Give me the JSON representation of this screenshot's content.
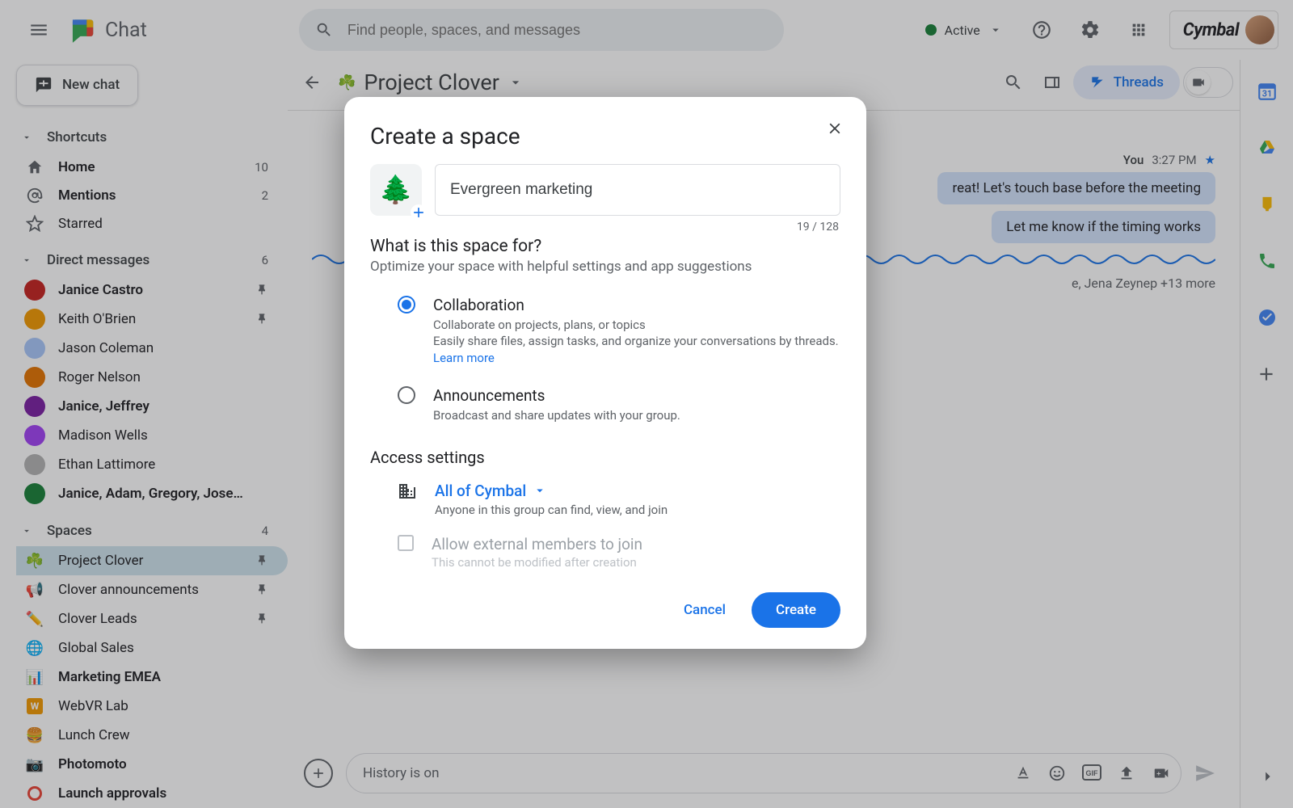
{
  "topbar": {
    "app_name": "Chat",
    "search_placeholder": "Find people, spaces, and messages",
    "active_label": "Active",
    "brand": "Cymbal"
  },
  "sidebar": {
    "new_chat": "New chat",
    "sections": {
      "shortcuts": {
        "label": "Shortcuts",
        "items": [
          {
            "label": "Home",
            "count": "10",
            "bold": true
          },
          {
            "label": "Mentions",
            "count": "2",
            "bold": true
          },
          {
            "label": "Starred"
          }
        ]
      },
      "dms": {
        "label": "Direct messages",
        "count": "6",
        "items": [
          {
            "label": "Janice Castro",
            "bold": true,
            "pin": true
          },
          {
            "label": "Keith O'Brien",
            "pin": true
          },
          {
            "label": "Jason Coleman"
          },
          {
            "label": "Roger Nelson"
          },
          {
            "label": "Janice, Jeffrey",
            "bold": true
          },
          {
            "label": "Madison Wells"
          },
          {
            "label": "Ethan Lattimore"
          },
          {
            "label": "Janice, Adam, Gregory, Jose…",
            "bold": true
          }
        ]
      },
      "spaces": {
        "label": "Spaces",
        "count": "4",
        "items": [
          {
            "emoji": "☘️",
            "label": "Project Clover",
            "pin": true,
            "active": true
          },
          {
            "emoji": "📢",
            "label": "Clover announcements",
            "pin": true
          },
          {
            "emoji": "✏️",
            "label": "Clover Leads",
            "pin": true
          },
          {
            "emoji": "🌐",
            "label": "Global Sales"
          },
          {
            "emoji": "📊",
            "label": "Marketing EMEA",
            "bold": true
          },
          {
            "emoji": "W",
            "label": "WebVR Lab"
          },
          {
            "emoji": "🍔",
            "label": "Lunch Crew"
          },
          {
            "emoji": "📷",
            "label": "Photomoto",
            "bold": true
          },
          {
            "emoji": "◯",
            "label": "Launch approvals",
            "bold": true
          }
        ]
      }
    }
  },
  "conv": {
    "title": "Project Clover",
    "threads_label": "Threads",
    "meta_you": "You",
    "meta_time": "3:27 PM",
    "msg1": "reat! Let's touch base before the meeting",
    "msg2": "Let me know if the timing works",
    "viewers": "e, Jena Zeynep +13 more",
    "composer_placeholder": "History is on"
  },
  "dialog": {
    "title": "Create a space",
    "emoji": "🌲",
    "name_value": "Evergreen marketing",
    "counter": "19 / 128",
    "section1_hd": "What is this space for?",
    "section1_txt": "Optimize your space with helpful settings and app suggestions",
    "opt_collab": {
      "title": "Collaboration",
      "desc": "Collaborate on projects, plans, or topics\nEasily share files, assign tasks, and organize your conversations by threads.",
      "learn": "Learn more"
    },
    "opt_announce": {
      "title": "Announcements",
      "desc": "Broadcast and share updates with your group."
    },
    "access_hd": "Access settings",
    "access_name": "All of Cymbal",
    "access_desc": "Anyone in this group can find, view, and join",
    "ext_name": "Allow external members to join",
    "ext_desc": "This cannot be modified after creation",
    "cancel": "Cancel",
    "create": "Create"
  }
}
